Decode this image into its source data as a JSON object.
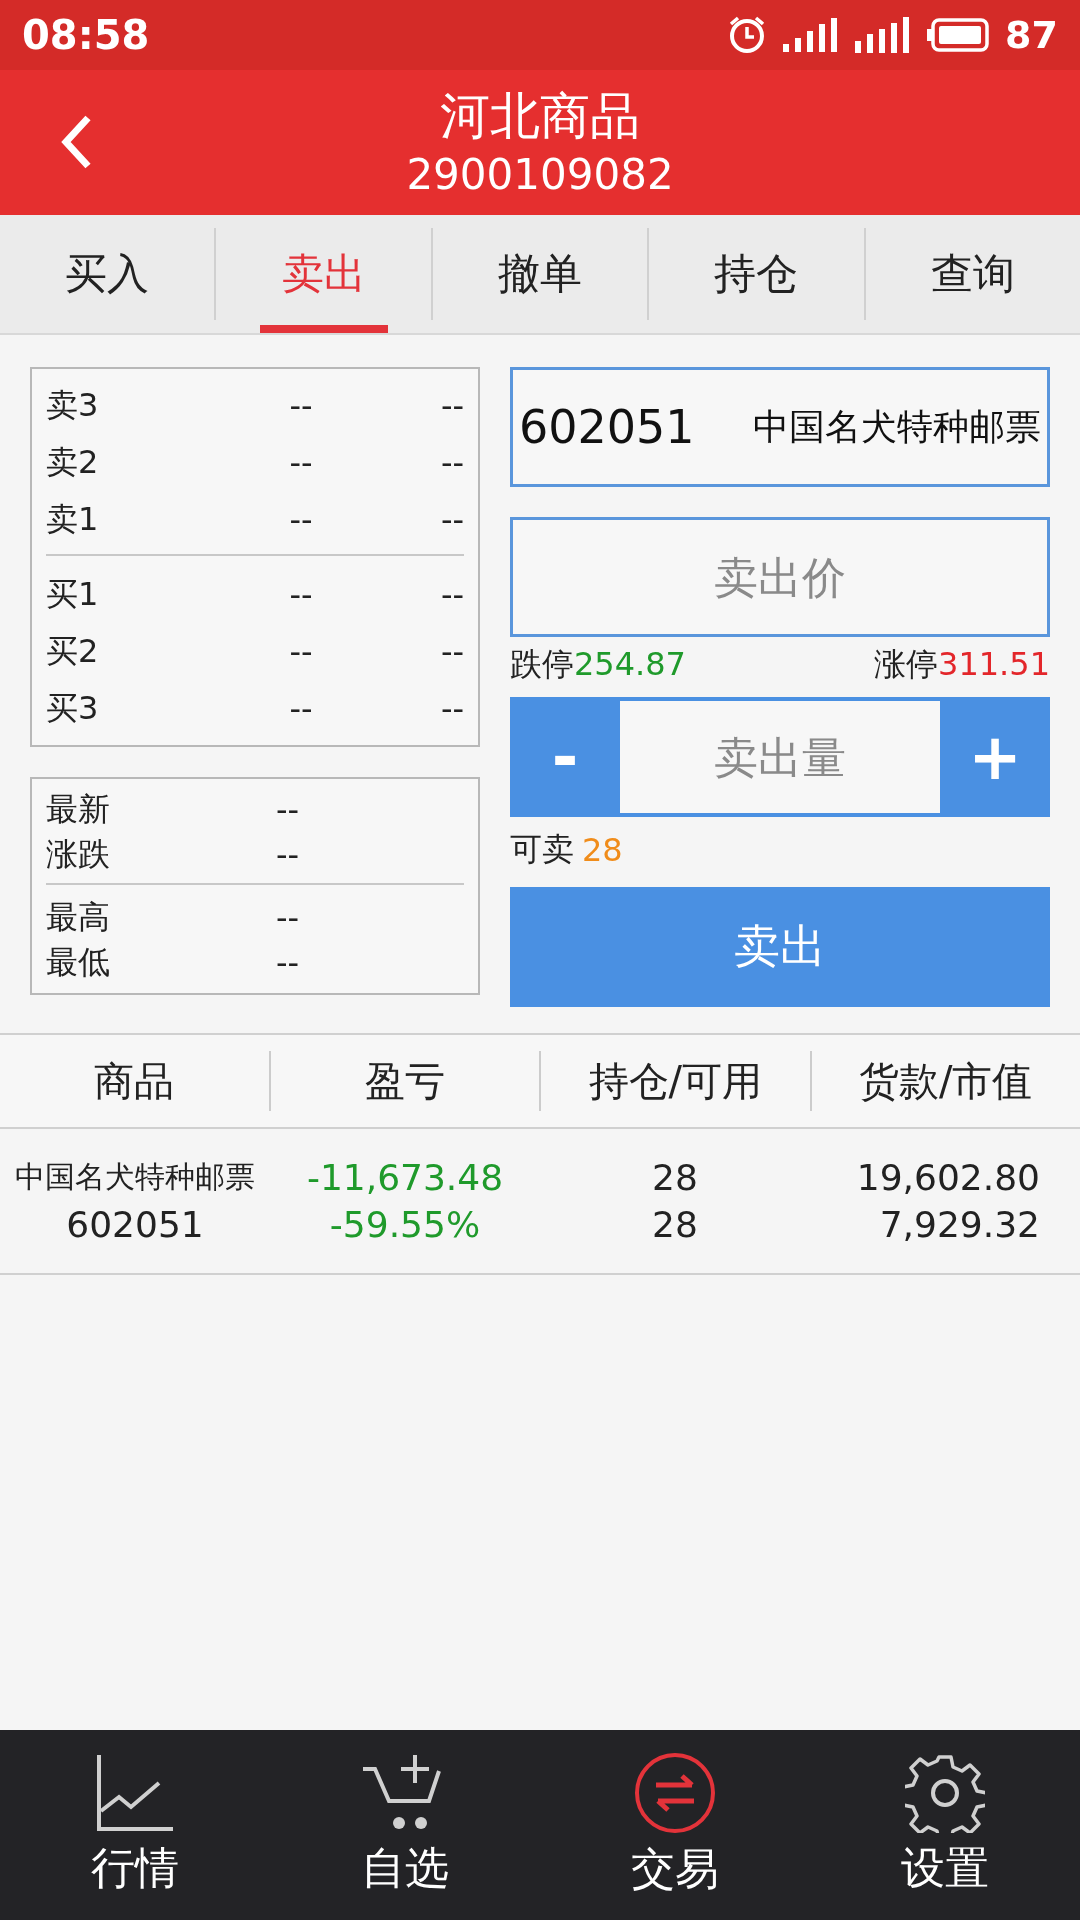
{
  "status_bar": {
    "time": "08:58",
    "battery": "87"
  },
  "header": {
    "title": "河北商品",
    "account": "2900109082"
  },
  "tabs": [
    {
      "label": "买入",
      "selected": false
    },
    {
      "label": "卖出",
      "selected": true
    },
    {
      "label": "撤单",
      "selected": false
    },
    {
      "label": "持仓",
      "selected": false
    },
    {
      "label": "查询",
      "selected": false
    }
  ],
  "order_book": {
    "asks": [
      {
        "label": "卖3",
        "price": "--",
        "volume": "--"
      },
      {
        "label": "卖2",
        "price": "--",
        "volume": "--"
      },
      {
        "label": "卖1",
        "price": "--",
        "volume": "--"
      }
    ],
    "bids": [
      {
        "label": "买1",
        "price": "--",
        "volume": "--"
      },
      {
        "label": "买2",
        "price": "--",
        "volume": "--"
      },
      {
        "label": "买3",
        "price": "--",
        "volume": "--"
      }
    ]
  },
  "stats": [
    [
      {
        "label": "最新",
        "value": "--"
      },
      {
        "label": "涨跌",
        "value": "--"
      }
    ],
    [
      {
        "label": "最高",
        "value": "--"
      },
      {
        "label": "最低",
        "value": "--"
      }
    ]
  ],
  "order_form": {
    "code": "602051",
    "name": "中国名犬特种邮票",
    "price_placeholder": "卖出价",
    "limit_down_label": "跌停",
    "limit_down": "254.87",
    "limit_up_label": "涨停",
    "limit_up": "311.51",
    "decrease": "-",
    "quantity_placeholder": "卖出量",
    "increase": "+",
    "available_label": "可卖",
    "available": "28",
    "submit": "卖出"
  },
  "positions": {
    "columns": [
      "商品",
      "盈亏",
      "持仓/可用",
      "货款/市值"
    ],
    "rows": [
      {
        "name": "中国名犬特种邮票",
        "code": "602051",
        "profit": "-11,673.48",
        "profit_pct": "-59.55%",
        "holding": "28",
        "available": "28",
        "cost": "19,602.80",
        "market_value": "7,929.32"
      }
    ]
  },
  "bottom_nav": [
    {
      "label": "行情",
      "kind": "chart",
      "selected": false
    },
    {
      "label": "自选",
      "kind": "cart",
      "selected": false
    },
    {
      "label": "交易",
      "kind": "exchange",
      "selected": true
    },
    {
      "label": "设置",
      "kind": "gear",
      "selected": false
    }
  ]
}
